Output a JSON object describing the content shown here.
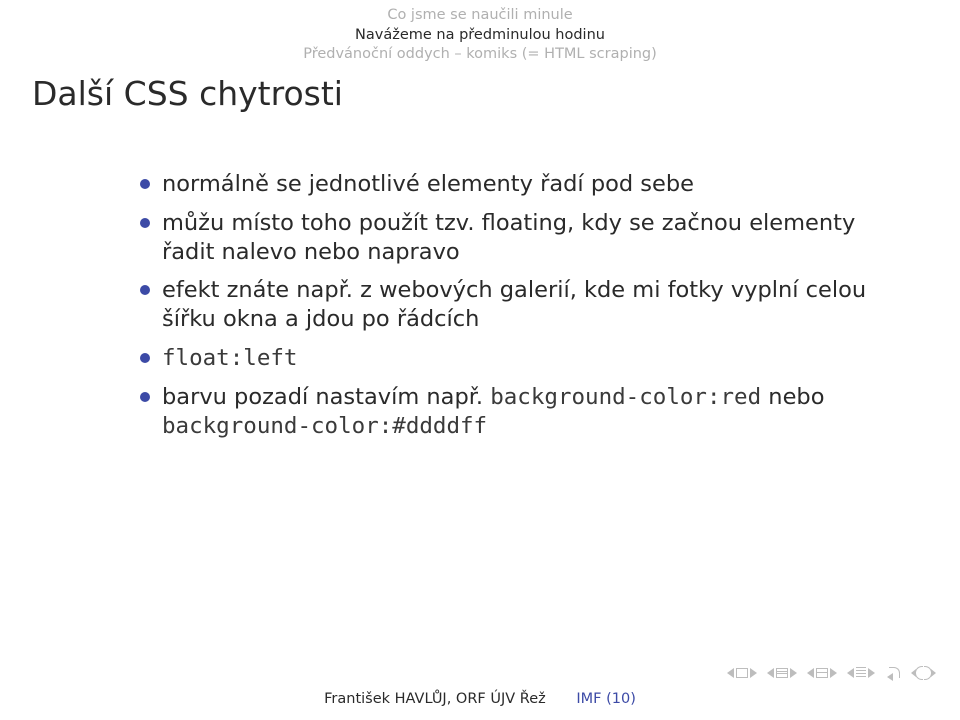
{
  "headnav": {
    "line1": "Co jsme se naučili minule",
    "line2": "Navážeme na předminulou hodinu",
    "line3": "Předvánoční oddych – komiks (= HTML scraping)"
  },
  "title": "Další CSS chytrosti",
  "bullets": {
    "b1a": "normálně se jednotlivé elementy řadí pod sebe",
    "b2a": "můžu místo toho použít tzv. floating, kdy se začnou elementy řadit nalevo nebo napravo",
    "b3a": "efekt znáte např. z webových galerií, kde mi fotky vyplní celou šířku okna a jdou po řádcích",
    "b4code": "float:left",
    "b5a": "barvu pozadí nastavím např. ",
    "b5code1": "background-color:red",
    "b5b": " nebo ",
    "b5code2": "background-color:#ddddff"
  },
  "footer": {
    "author": "František HAVLŮJ, ORF ÚJV Řež",
    "course": "IMF (10)"
  },
  "nav_icons": {
    "first": "go-first-icon",
    "frame_prev": "frame-prev-icon",
    "frame_next": "frame-next-icon",
    "section_prev": "section-prev-icon",
    "section_next": "section-next-icon",
    "subsection_prev": "subsection-prev-icon",
    "subsection_next": "subsection-next-icon",
    "slide_prev": "slide-prev-icon",
    "slide_next": "slide-next-icon",
    "back": "back-icon",
    "search": "search-cycle-icon"
  }
}
